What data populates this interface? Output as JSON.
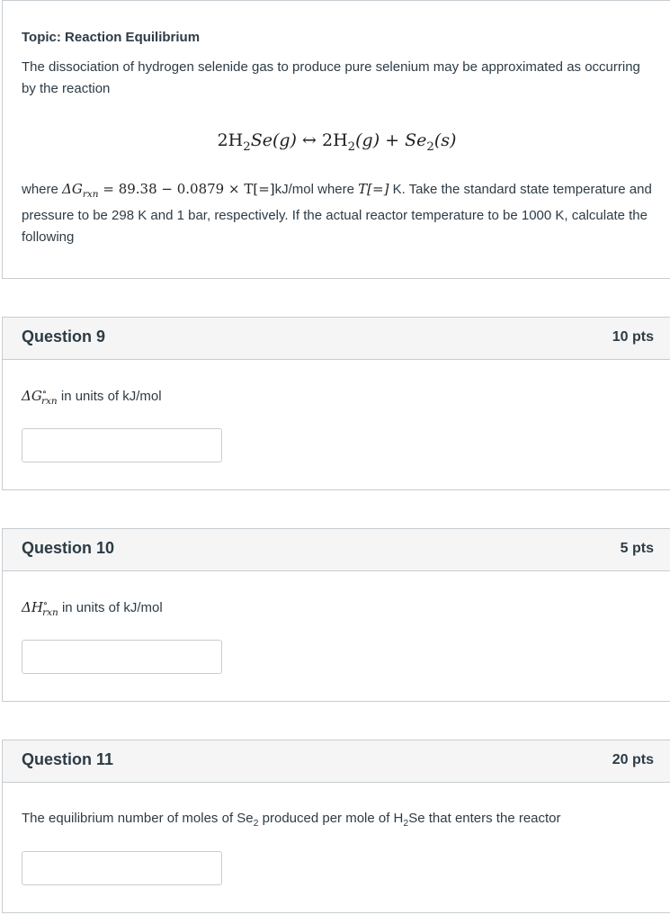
{
  "intro": {
    "topic": "Topic: Reaction Equilibrium",
    "paragraph1": "The dissociation of hydrogen selenide gas to produce pure selenium may be approximated as occurring by the reaction",
    "reaction": {
      "left": "2H",
      "left_sub": "2",
      "left_rest": "Se(g)",
      "arrow": "↔",
      "right1": "2H",
      "right1_sub": "2",
      "right1_rest": "(g) + Se",
      "right2_sub": "2",
      "right2_rest": "(s)"
    },
    "p2_where": "where",
    "p2_eq": "ΔG",
    "p2_eq_sub": "rxn",
    "p2_eq_rest": "= 89.38 − 0.0879 × T[=]",
    "p2_unit": "kJ/mol where",
    "p2_T": "T[=]",
    "p2_after": "K. Take the standard state temperature and pressure to be 298 K and 1 bar, respectively. If the actual reactor temperature to be 1000 K, calculate the following"
  },
  "questions": [
    {
      "title": "Question 9",
      "points": "10 pts",
      "symbol": "ΔG",
      "symbol_sup": "∘",
      "symbol_sub": "rxn",
      "prompt": "in units of kJ/mol",
      "answer_value": ""
    },
    {
      "title": "Question 10",
      "points": "5 pts",
      "symbol": "ΔH",
      "symbol_sup": "∘",
      "symbol_sub": "rxn",
      "prompt": "in units of kJ/mol",
      "answer_value": ""
    },
    {
      "title": "Question 11",
      "points": "20 pts",
      "prompt_a": "The equilibrium number of moles of Se",
      "prompt_sub1": "2",
      "prompt_b": "produced per mole of H",
      "prompt_sub2": "2",
      "prompt_c": "Se that enters the reactor",
      "answer_value": ""
    }
  ]
}
